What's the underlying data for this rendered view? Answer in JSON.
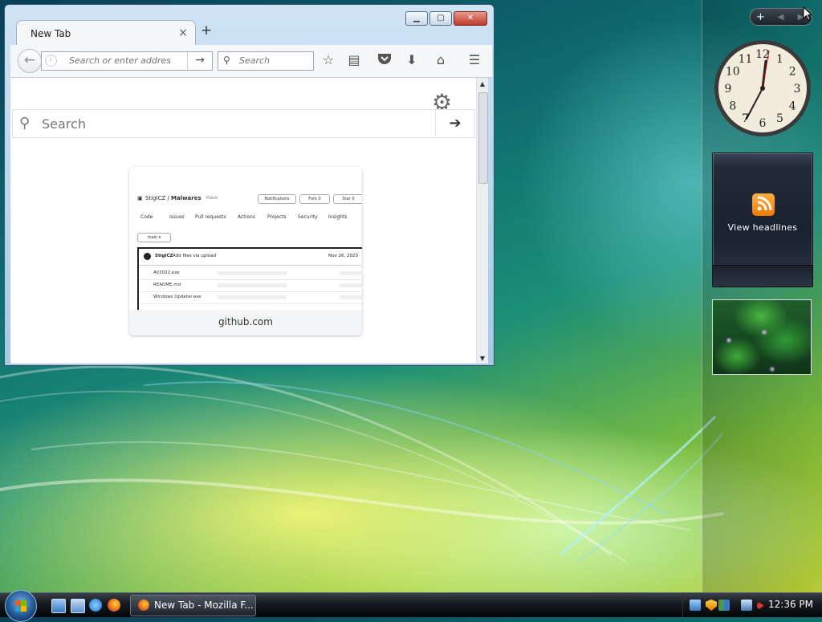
{
  "sidebar": {
    "controls": {
      "add": "+",
      "prev": "◀",
      "next": "▶"
    },
    "clock": {
      "numbers": [
        "12",
        "1",
        "2",
        "3",
        "4",
        "5",
        "6",
        "7",
        "8",
        "9",
        "10",
        "11"
      ]
    },
    "feed": {
      "label": "View headlines"
    }
  },
  "browser": {
    "tab_title": "New Tab",
    "tab_close": "×",
    "new_tab": "+",
    "url_placeholder": "Search or enter addres",
    "search_placeholder": "Search",
    "newtab_search_placeholder": "Search",
    "tile": {
      "site": "github.com",
      "repo_owner": "StigICZ /",
      "repo_name": "Malwares",
      "visibility": "Public",
      "buttons": [
        "Notifications",
        "Fork 0",
        "Star 0"
      ],
      "nav": [
        "Code",
        "Issues",
        "Pull requests",
        "Actions",
        "Projects",
        "Security",
        "Insights"
      ],
      "branch": "main ▾",
      "commit_user": "StigICZ",
      "commit_msg": "Add files via upload",
      "commit_date": "Nov 26, 2023",
      "files": [
        "AV2022.exe",
        "README.md",
        "Windows Updater.exe"
      ]
    }
  },
  "taskbar": {
    "task_label": "New Tab - Mozilla F...",
    "time": "12:36 PM"
  }
}
